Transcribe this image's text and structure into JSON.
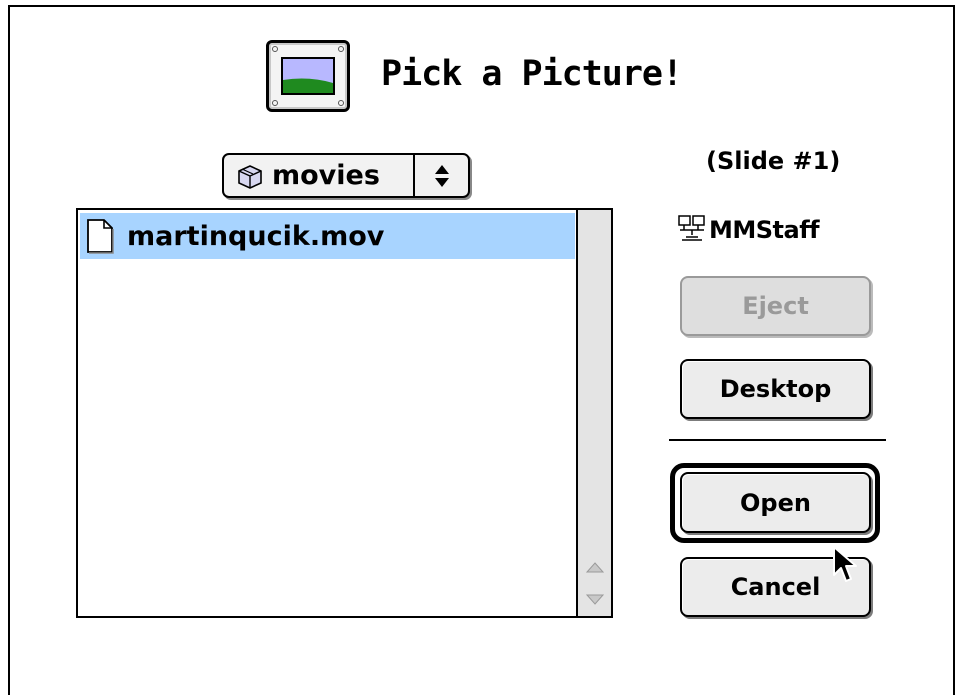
{
  "dialog": {
    "title": "Pick a Picture!",
    "title_icon": "picture-icon"
  },
  "folder_popup": {
    "icon": "folder-icon",
    "label": "movies",
    "arrows_icon": "updown-arrows-icon"
  },
  "file_list": {
    "items": [
      {
        "name": "martinqucik.mov",
        "icon": "document-icon",
        "selected": true
      }
    ]
  },
  "slide_label": "(Slide #1)",
  "volume": {
    "icon": "network-volume-icon",
    "name": "MMStaff"
  },
  "buttons": {
    "eject": {
      "label": "Eject",
      "enabled": false
    },
    "desktop": {
      "label": "Desktop"
    },
    "open": {
      "label": "Open",
      "default": true
    },
    "cancel": {
      "label": "Cancel"
    }
  },
  "colors": {
    "selection": "#a8d4ff",
    "picture_sky": "#b8b8ff",
    "picture_grass": "#1f8a1f"
  }
}
